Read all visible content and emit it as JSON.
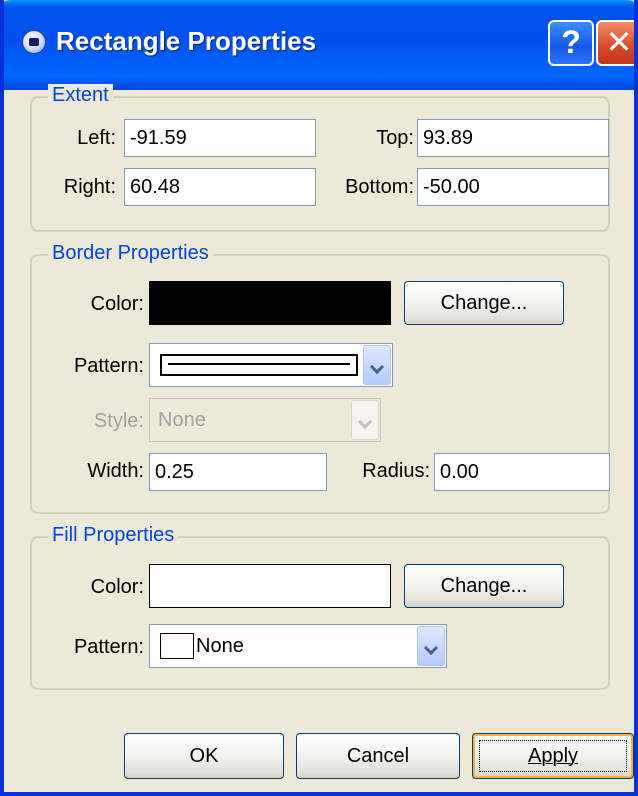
{
  "window": {
    "title": "Rectangle Properties",
    "help_glyph": "?",
    "close_glyph": "✕"
  },
  "extent": {
    "title": "Extent",
    "left_label": "Left:",
    "left_value": "-91.59",
    "top_label": "Top:",
    "top_value": "93.89",
    "right_label": "Right:",
    "right_value": "60.48",
    "bottom_label": "Bottom:",
    "bottom_value": "-50.00"
  },
  "border": {
    "title": "Border Properties",
    "color_label": "Color:",
    "color_value": "#000000",
    "change_label": "Change...",
    "pattern_label": "Pattern:",
    "style_label": "Style:",
    "style_value": "None",
    "width_label": "Width:",
    "width_value": "0.25",
    "radius_label": "Radius:",
    "radius_value": "0.00"
  },
  "fill": {
    "title": "Fill Properties",
    "color_label": "Color:",
    "color_value": "#FFFFFF",
    "change_label": "Change...",
    "pattern_label": "Pattern:",
    "pattern_value": "None"
  },
  "buttons": {
    "ok_label": "OK",
    "cancel_label": "Cancel",
    "apply_label": "Apply"
  },
  "colors": {
    "titlebar": "#0054E3",
    "group_title": "#0046D5",
    "dialog_bg": "#ECE9D8"
  }
}
